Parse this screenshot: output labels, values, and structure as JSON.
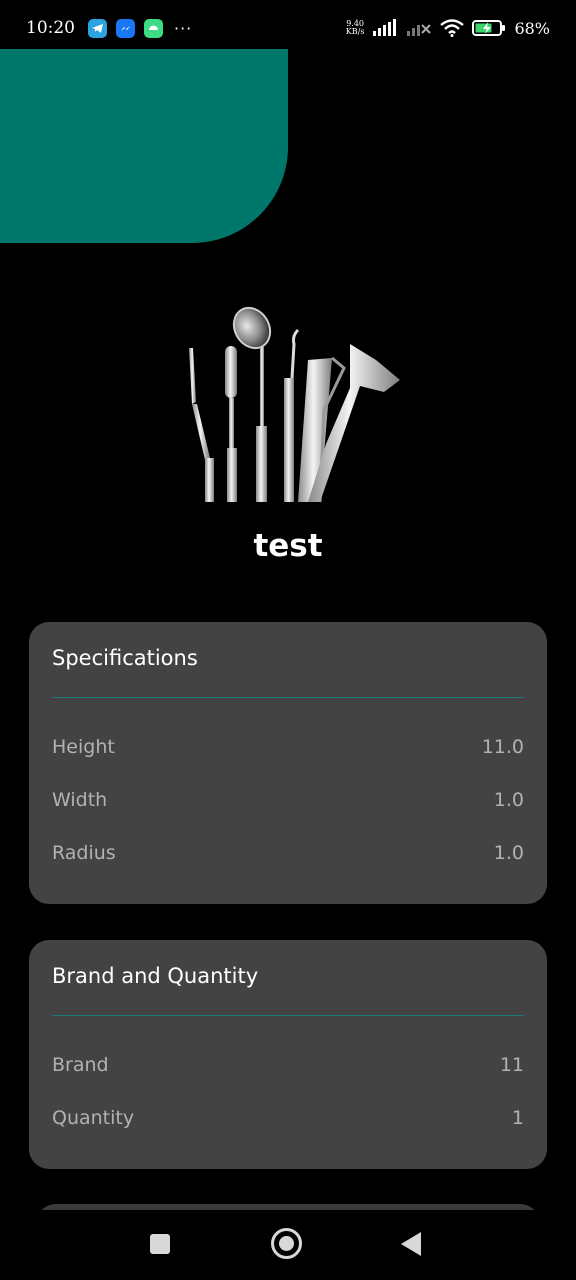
{
  "status_bar": {
    "time": "10:20",
    "network_speed_value": "9.40",
    "network_speed_unit": "KB/s",
    "battery_percent": "68%",
    "notification_icons": [
      "telegram-icon",
      "messenger-icon",
      "android-icon"
    ],
    "more_indicator": "···"
  },
  "colors": {
    "accent": "#00776b",
    "background": "#000000",
    "card": "#434343",
    "divider": "#1a7b74",
    "label": "#b2b2b2"
  },
  "product": {
    "image_icon": "dental-instruments-image",
    "title": "test"
  },
  "specifications": {
    "title": "Specifications",
    "rows": [
      {
        "label": "Height",
        "value": "11.0"
      },
      {
        "label": "Width",
        "value": "1.0"
      },
      {
        "label": "Radius",
        "value": "1.0"
      }
    ]
  },
  "brand_quantity": {
    "title": "Brand and Quantity",
    "rows": [
      {
        "label": "Brand",
        "value": "11"
      },
      {
        "label": "Quantity",
        "value": "1"
      }
    ]
  },
  "nav": {
    "icons": [
      "recents-icon",
      "home-icon",
      "back-icon"
    ]
  }
}
